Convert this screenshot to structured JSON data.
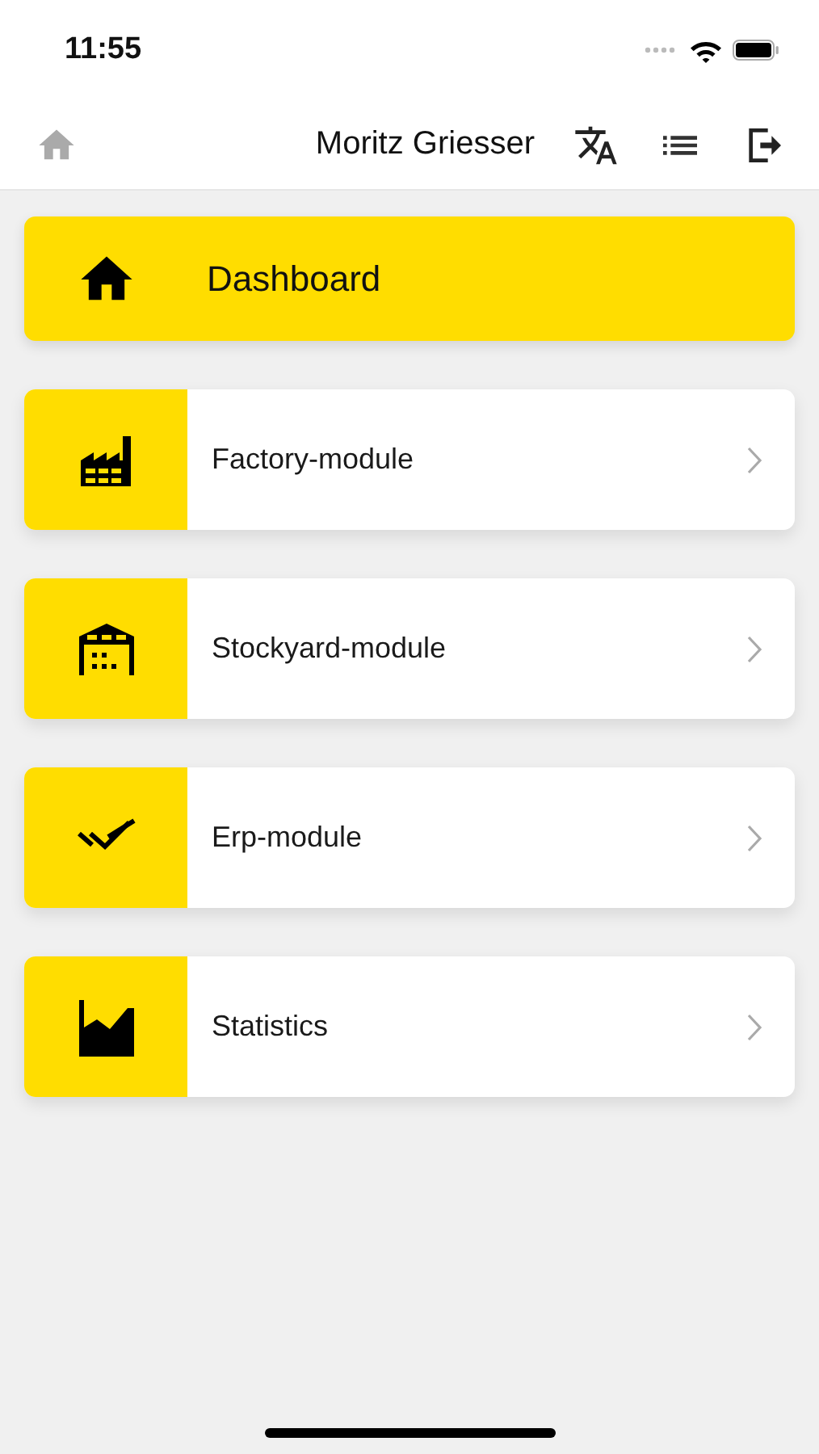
{
  "status_bar": {
    "time": "11:55"
  },
  "header": {
    "home": {
      "disabled": true
    },
    "user": "Moritz Griesser"
  },
  "dashboard": {
    "title": "Dashboard"
  },
  "modules": [
    {
      "kind": "factory",
      "label": "Factory-module"
    },
    {
      "kind": "warehouse",
      "label": "Stockyard-module"
    },
    {
      "kind": "checks",
      "label": "Erp-module"
    },
    {
      "kind": "chart",
      "label": "Statistics"
    }
  ]
}
